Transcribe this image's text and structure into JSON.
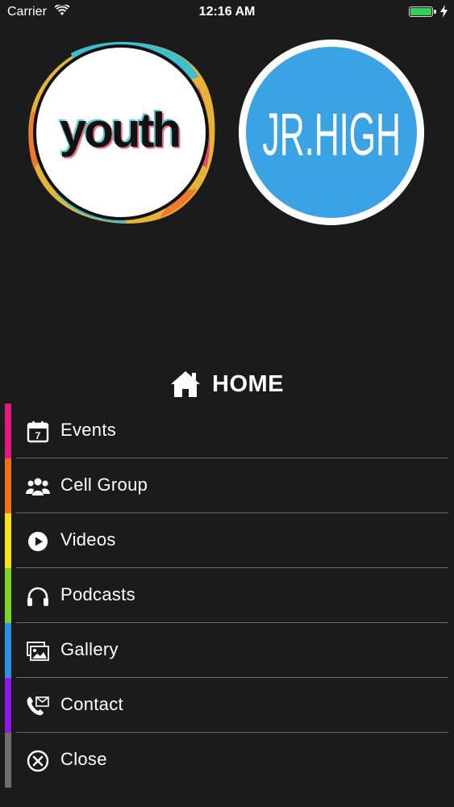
{
  "status_bar": {
    "carrier": "Carrier",
    "time": "12:16 AM",
    "battery_color": "#2fd158"
  },
  "logos": {
    "youth": {
      "text": "youth"
    },
    "jr_high": {
      "text": "JR.HIGH",
      "color": "#3ba3e3"
    }
  },
  "home": {
    "title": "HOME",
    "icon": "home-icon"
  },
  "menu": {
    "items": [
      {
        "label": "Events",
        "icon": "calendar-icon",
        "calendar_day": "7",
        "color": "#e3197d"
      },
      {
        "label": "Cell Group",
        "icon": "group-icon",
        "color": "#ef6f1b"
      },
      {
        "label": "Videos",
        "icon": "play-icon",
        "color": "#f7e31b"
      },
      {
        "label": "Podcasts",
        "icon": "headphones-icon",
        "color": "#7fd22a"
      },
      {
        "label": "Gallery",
        "icon": "gallery-icon",
        "color": "#2c8ee4"
      },
      {
        "label": "Contact",
        "icon": "contact-icon",
        "color": "#8c1ae8"
      },
      {
        "label": "Close",
        "icon": "close-icon",
        "color": "#6e6e6e"
      }
    ]
  }
}
